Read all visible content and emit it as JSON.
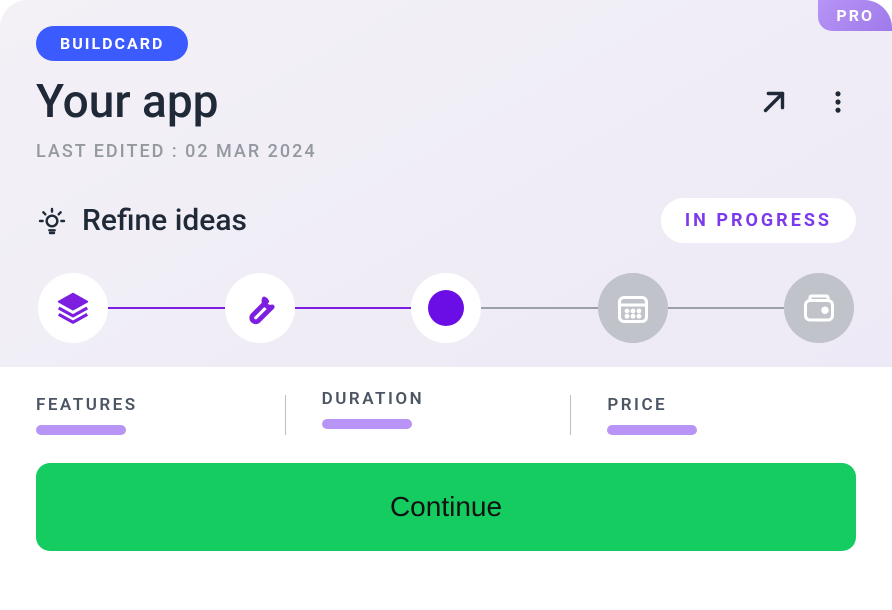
{
  "pro_badge": "PRO",
  "buildcard_badge": "BUILDCARD",
  "app_title": "Your app",
  "last_edited": "LAST EDITED : 02 MAR 2024",
  "refine_text": "Refine ideas",
  "status": "IN PROGRESS",
  "metrics": {
    "features_label": "FEATURES",
    "duration_label": "DURATION",
    "price_label": "PRICE"
  },
  "continue_label": "Continue"
}
